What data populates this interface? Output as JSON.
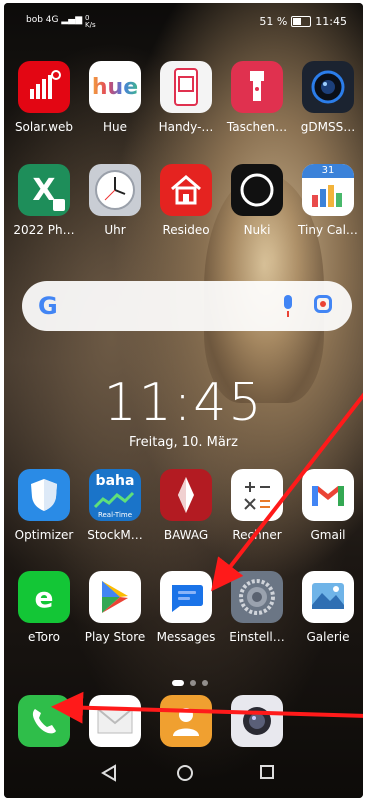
{
  "status": {
    "left": "bob 4G",
    "speed_value": "0",
    "speed_unit": "K/s",
    "battery": "51 %",
    "time": "11:45"
  },
  "row1": [
    {
      "label": "Solar.web",
      "icon": "solarweb-icon",
      "bg": "#e30613"
    },
    {
      "label": "Hue",
      "icon": "hue-icon",
      "bg": "#ffffff"
    },
    {
      "label": "Handy-…",
      "icon": "phone-app-icon",
      "bg": "#e84a5f"
    },
    {
      "label": "Taschen…",
      "icon": "flashlight-icon",
      "bg": "#e0314f"
    },
    {
      "label": "gDMSS…",
      "icon": "camera-lens-icon",
      "bg": "#1b2330"
    }
  ],
  "row2": [
    {
      "label": "2022 Ph…",
      "icon": "spreadsheet-icon",
      "bg": "#1e8e5a"
    },
    {
      "label": "Uhr",
      "icon": "clock-icon",
      "bg": "#c9cdd4"
    },
    {
      "label": "Resideo",
      "icon": "house-icon",
      "bg": "#e52320"
    },
    {
      "label": "Nuki",
      "icon": "ring-icon",
      "bg": "#111111"
    },
    {
      "label": "Tiny Cal…",
      "icon": "calendar-icon",
      "bg": "#ffffff"
    }
  ],
  "clock": {
    "time": "11:45",
    "date": "Freitag, 10. März"
  },
  "row3": [
    {
      "label": "Optimizer",
      "icon": "shield-icon",
      "bg": "#2a8be6"
    },
    {
      "label": "StockM…",
      "icon": "baha-icon",
      "bg": "#1a74c9"
    },
    {
      "label": "BAWAG",
      "icon": "bawag-icon",
      "bg": "#b31b22"
    },
    {
      "label": "Rechner",
      "icon": "calculator-icon",
      "bg": "#ffffff"
    },
    {
      "label": "Gmail",
      "icon": "gmail-icon",
      "bg": "#ffffff"
    }
  ],
  "row4": [
    {
      "label": "eToro",
      "icon": "etoro-icon",
      "bg": "#13c636"
    },
    {
      "label": "Play Store",
      "icon": "play-store-icon",
      "bg": "#ffffff"
    },
    {
      "label": "Messages",
      "icon": "messages-icon",
      "bg": "#ffffff"
    },
    {
      "label": "Einstell…",
      "icon": "settings-icon",
      "bg": "#6b7685"
    },
    {
      "label": "Galerie",
      "icon": "gallery-icon",
      "bg": "#ffffff"
    }
  ],
  "dock": [
    {
      "icon": "phone-icon",
      "bg": "#2fbe4a"
    },
    {
      "icon": "mail-icon",
      "bg": "#ffffff"
    },
    {
      "icon": "contacts-icon",
      "bg": "#f0a030"
    },
    {
      "icon": "camera-icon",
      "bg": "#e8e8ee"
    }
  ],
  "search": {
    "g": "G"
  },
  "colors": {
    "arrow": "#ff1a1a"
  }
}
